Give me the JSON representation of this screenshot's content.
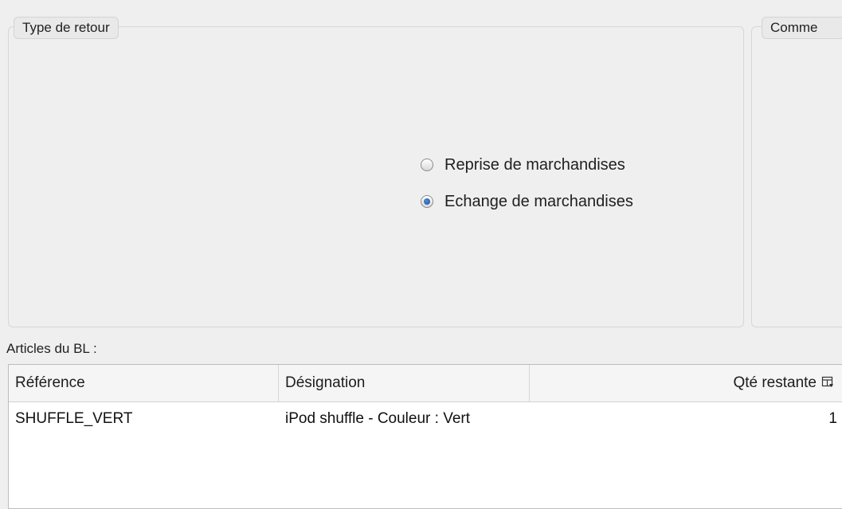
{
  "return_type": {
    "title": "Type de retour",
    "options": [
      {
        "label": "Reprise de marchandises",
        "selected": false
      },
      {
        "label": "Echange de marchandises",
        "selected": true
      }
    ]
  },
  "comments": {
    "title": "Comme"
  },
  "articles": {
    "label": "Articles du BL :",
    "columns": [
      "Référence",
      "Désignation",
      "Qté restante"
    ],
    "rows": [
      {
        "reference": "SHUFFLE_VERT",
        "designation": "iPod shuffle - Couleur : Vert",
        "quantity": "1"
      }
    ],
    "options_icon": "table-columns-icon"
  }
}
